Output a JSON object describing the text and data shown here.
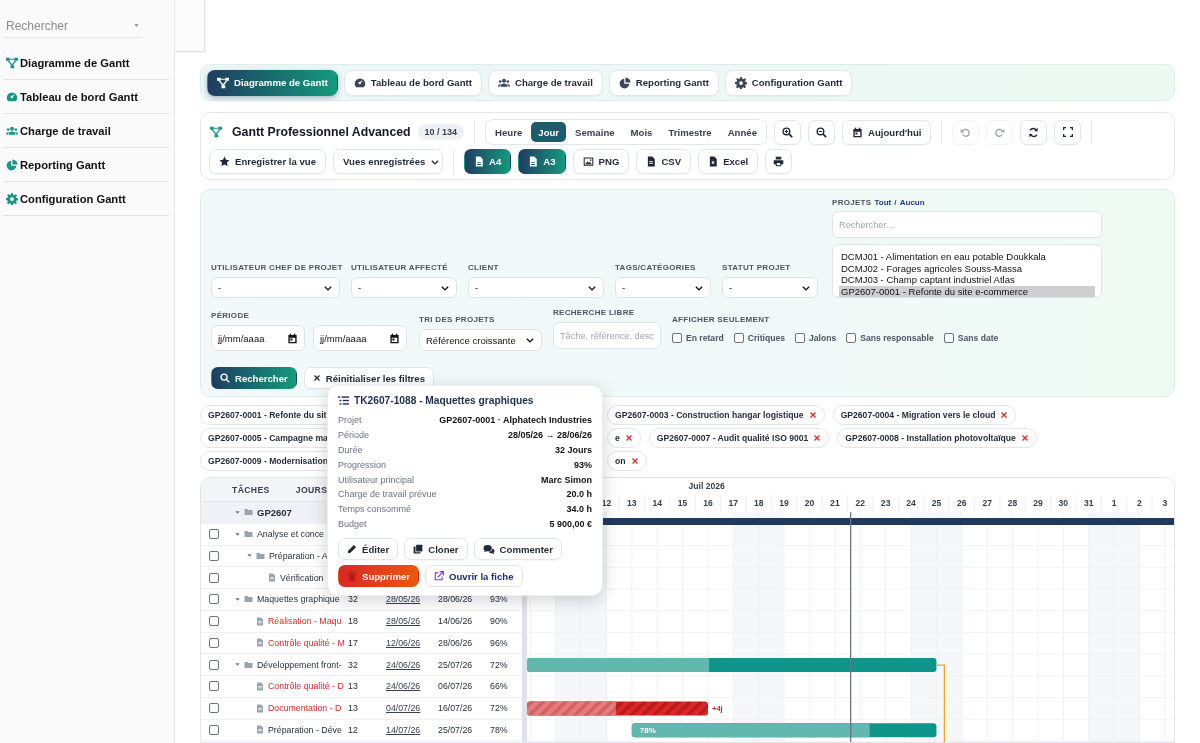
{
  "sidebar": {
    "search": {
      "placeholder": "Rechercher"
    },
    "items": [
      {
        "label": "Diagramme de Gantt"
      },
      {
        "label": "Tableau de bord Gantt"
      },
      {
        "label": "Charge de travail"
      },
      {
        "label": "Reporting Gantt"
      },
      {
        "label": "Configuration Gantt"
      }
    ]
  },
  "tabs": [
    {
      "label": "Diagramme de Gantt",
      "selected": true
    },
    {
      "label": "Tableau de bord Gantt",
      "selected": false
    },
    {
      "label": "Charge de travail",
      "selected": false
    },
    {
      "label": "Reporting Gantt",
      "selected": false
    },
    {
      "label": "Configuration Gantt",
      "selected": false
    }
  ],
  "toolbar": {
    "title": "Gantt Professionnel Advanced",
    "count": "10 / 134",
    "scales": [
      {
        "label": "Heure",
        "selected": false
      },
      {
        "label": "Jour",
        "selected": true
      },
      {
        "label": "Semaine",
        "selected": false
      },
      {
        "label": "Mois",
        "selected": false
      },
      {
        "label": "Trimestre",
        "selected": false
      },
      {
        "label": "Année",
        "selected": false
      }
    ],
    "today_button": "Aujourd'hui",
    "history": [
      {
        "kind": "undo",
        "disabled": true
      },
      {
        "kind": "redo",
        "disabled": true
      }
    ],
    "save_view": "Enregistrer la vue",
    "saved_views": "Vues enregistrées",
    "exports": [
      {
        "label": "A4",
        "kind": "pdf",
        "primary": true
      },
      {
        "label": "A3",
        "kind": "pdf",
        "primary": true
      },
      {
        "label": "PNG",
        "kind": "image",
        "primary": false
      },
      {
        "label": "CSV",
        "kind": "file",
        "primary": false
      },
      {
        "label": "Excel",
        "kind": "sheet",
        "primary": false
      }
    ]
  },
  "filters": {
    "selects": [
      {
        "label": "UTILISATEUR CHEF DE PROJET",
        "value": "-"
      },
      {
        "label": "UTILISATEUR AFFECTÉ",
        "value": "-"
      },
      {
        "label": "CLIENT",
        "value": "-"
      },
      {
        "label": "TAGS/CATÉGORIES",
        "value": "-"
      },
      {
        "label": "STATUT PROJET",
        "value": "-"
      }
    ],
    "period": {
      "label": "PÉRIODE",
      "from": "jj/mm/aaaa",
      "to": "jj/mm/aaaa"
    },
    "sort": {
      "label": "TRI DES PROJETS",
      "value": "Référence croissante"
    },
    "search": {
      "label": "RECHERCHE LIBRE",
      "placeholder": "Tâche, référence, desc"
    },
    "only": {
      "label": "AFFICHER SEULEMENT",
      "options": [
        {
          "label": "En retard",
          "checked": false
        },
        {
          "label": "Critiques",
          "checked": false
        },
        {
          "label": "Jalons",
          "checked": false
        },
        {
          "label": "Sans responsable",
          "checked": false
        },
        {
          "label": "Sans date",
          "checked": false
        }
      ]
    },
    "projects": {
      "label": "PROJETS",
      "all": "Tout",
      "separator": "/",
      "none": "Aucun",
      "search_placeholder": "Rechercher...",
      "options": [
        {
          "label": "DCMJ01 - Alimentation en eau potable Doukkala",
          "selected": false
        },
        {
          "label": "DCMJ02 - Forages agricoles Souss-Massa",
          "selected": false
        },
        {
          "label": "DCMJ03 - Champ captant industriel Atlas",
          "selected": false
        },
        {
          "label": "GP2607-0001 - Refonte du site e-commerce",
          "selected": true
        }
      ]
    },
    "search_button": "Rechercher",
    "reset_button": "Réinitialiser les filtres"
  },
  "chips": [
    [
      {
        "label": "GP2607-0001 - Refonte du sit",
        "removable": false
      },
      {
        "label": "GP2607-0003 - Construction hangar logistique",
        "removable": true
      },
      {
        "label": "GP2607-0004 - Migration vers le cloud",
        "removable": true
      }
    ],
    [
      {
        "label": "GP2607-0005 - Campagne ma",
        "removable": false
      },
      {
        "label": "e",
        "removable": true
      },
      {
        "label": "GP2607-0007 - Audit qualité ISO 9001",
        "removable": true
      },
      {
        "label": "GP2607-0008 - Installation photovoltaïque",
        "removable": true
      }
    ],
    [
      {
        "label": "GP2607-0009 - Modernisation",
        "removable": false
      },
      {
        "label": "on",
        "removable": true
      }
    ]
  ],
  "gantt": {
    "columns": [
      "TÂCHES",
      "JOURS"
    ],
    "month": "Juil 2026",
    "days": [
      "12",
      "13",
      "14",
      "15",
      "16",
      "17",
      "18",
      "19",
      "20",
      "21",
      "22",
      "23",
      "24",
      "25",
      "26",
      "27",
      "28",
      "29",
      "30",
      "31",
      "1",
      "2",
      "3"
    ],
    "tasks": [
      {
        "kind": "project",
        "name": "GP2607",
        "expanded": true,
        "children": [
          {
            "kind": "folder",
            "name": "Analyse et conce",
            "expanded": true,
            "checked": false,
            "late": false,
            "children": [
              {
                "kind": "folder",
                "name": "Préparation - A",
                "expanded": true,
                "checked": false,
                "late": false,
                "children": [
                  {
                    "kind": "task",
                    "name": "Vérification",
                    "checked": false,
                    "late": false
                  }
                ]
              }
            ]
          },
          {
            "kind": "folder",
            "name": "Maquettes graphique",
            "expanded": true,
            "checked": false,
            "late": false,
            "days": "32",
            "start": "28/05/26",
            "end": "28/06/26",
            "progress": "93%",
            "children": [
              {
                "kind": "task",
                "name": "Réalisation - Maqu",
                "checked": false,
                "late": true,
                "days": "18",
                "start": "28/05/26",
                "end": "14/06/26",
                "progress": "90%"
              },
              {
                "kind": "task",
                "name": "Contrôle qualité - M",
                "checked": false,
                "late": true,
                "days": "17",
                "start": "12/06/26",
                "end": "28/06/26",
                "progress": "96%"
              }
            ]
          },
          {
            "kind": "folder",
            "name": "Développement front-",
            "expanded": true,
            "checked": false,
            "late": false,
            "days": "32",
            "start": "24/06/26",
            "end": "25/07/26",
            "progress": "72%",
            "has_successor": true,
            "children": [
              {
                "kind": "task",
                "name": "Contrôle qualité - D",
                "checked": false,
                "late": true,
                "days": "13",
                "start": "24/06/26",
                "end": "06/07/26",
                "progress": "66%"
              },
              {
                "kind": "task",
                "name": "Documentation - D",
                "checked": false,
                "late": true,
                "days": "13",
                "start": "04/07/26",
                "end": "16/07/26",
                "progress": "72%",
                "delay": "+4j"
              },
              {
                "kind": "task",
                "name": "Préparation - Déve",
                "checked": false,
                "late": false,
                "days": "12",
                "start": "14/07/26",
                "end": "25/07/26",
                "progress": "78%",
                "bar_label": "78%"
              }
            ]
          }
        ]
      }
    ]
  },
  "popup": {
    "title": "TK2607-1088 - Maquettes graphiques",
    "fields": [
      {
        "label": "Projet",
        "value": "GP2607-0001 · Alphatech Industries"
      },
      {
        "label": "Période",
        "value": "28/05/26 → 28/06/26"
      },
      {
        "label": "Durée",
        "value": "32 Jours"
      },
      {
        "label": "Progression",
        "value": "93%"
      },
      {
        "label": "Utilisateur principal",
        "value": "Marc Simon"
      },
      {
        "label": "Charge de travail prévue",
        "value": "20.0 h"
      },
      {
        "label": "Temps consommé",
        "value": "34.0 h"
      },
      {
        "label": "Budget",
        "value": "5 900,00 €"
      }
    ],
    "actions": [
      {
        "label": "Éditer",
        "kind": "edit"
      },
      {
        "label": "Cloner",
        "kind": "clone"
      },
      {
        "label": "Commenter",
        "kind": "comment"
      },
      {
        "label": "Supprimer",
        "kind": "delete"
      },
      {
        "label": "Ouvrir la fiche",
        "kind": "open"
      }
    ]
  }
}
